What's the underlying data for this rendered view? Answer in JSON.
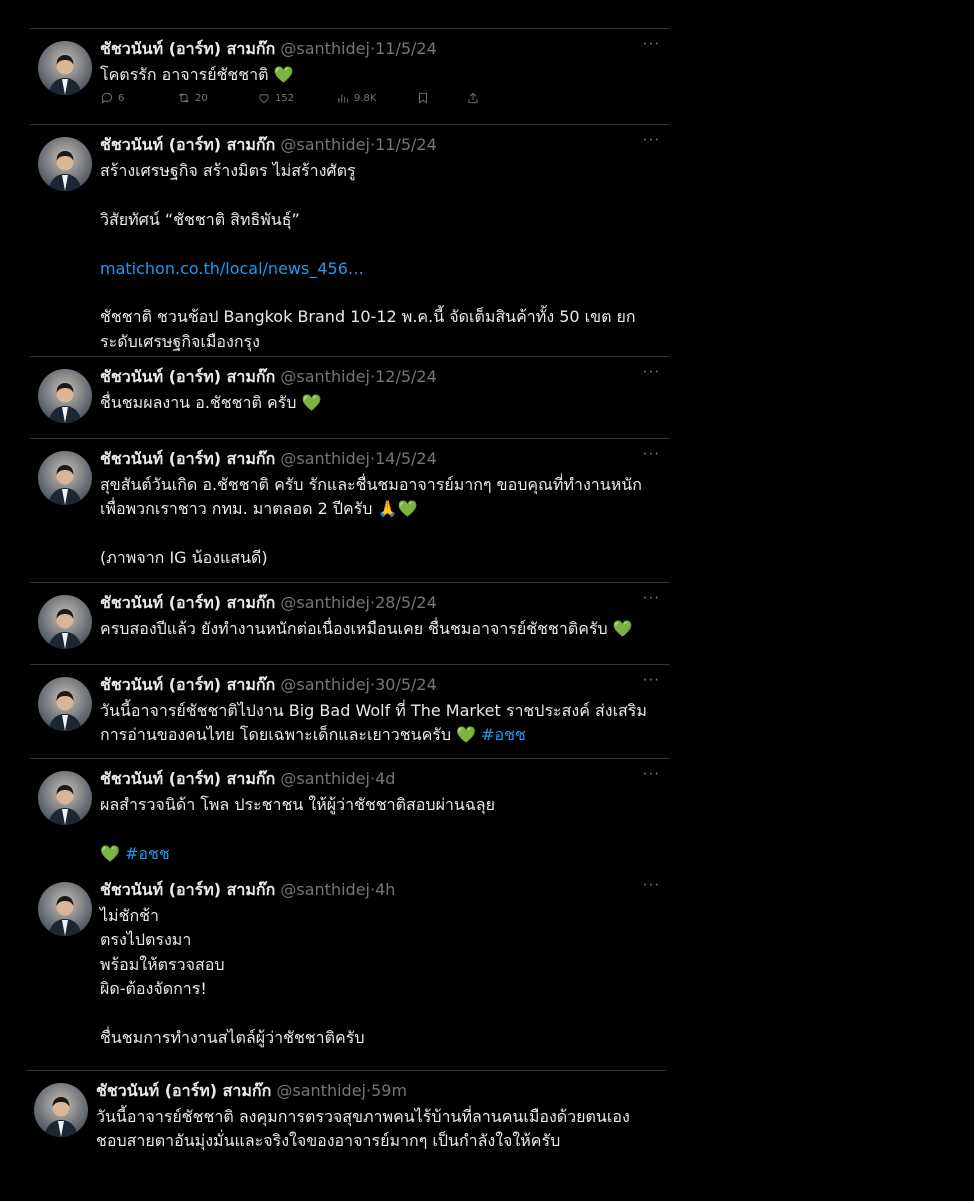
{
  "author": {
    "name": "ชัชวนันท์ (อาร์ท) สามก๊ก",
    "handle": "@santhidej",
    "sep": "·"
  },
  "tweets": [
    {
      "time": "11/5/24",
      "text": "โคตรรัก อาจารย์ชัชชาติ 💚",
      "metrics": {
        "replies": "6",
        "retweets": "20",
        "likes": "152",
        "views": "9.8K"
      }
    },
    {
      "time": "11/5/24",
      "text": "สร้างเศรษฐกิจ สร้างมิตร ไม่สร้างศัตรู\n\nวิสัยทัศน์ “ชัชชาติ สิทธิพันธุ์”\n\n",
      "link": "matichon.co.th/local/news_456…",
      "text_after": "\n\nชัชชาติ ชวนช้อป Bangkok Brand 10-12 พ.ค.นี้ จัดเต็มสินค้าทั้ง 50 เขต ยก\nระดับเศรษฐกิจเมืองกรุง"
    },
    {
      "time": "12/5/24",
      "text": "ชื่นชมผลงาน อ.ชัชชาติ ครับ 💚"
    },
    {
      "time": "14/5/24",
      "text": "สุขสันต์วันเกิด อ.ชัชชาติ ครับ รักและชื่นชมอาจารย์มากๆ ขอบคุณที่ทำงานหนัก\nเพื่อพวกเราชาว กทม. มาตลอด 2 ปีครับ 🙏💚\n\n(ภาพจาก IG น้องแสนดี)"
    },
    {
      "time": "28/5/24",
      "text": "ครบสองปีแล้ว ยังทำงานหนักต่อเนื่องเหมือนเคย ชื่นชมอาจารย์ชัชชาติครับ 💚"
    },
    {
      "time": "30/5/24",
      "text": "วันนี้อาจารย์ชัชชาติไปงาน Big Bad Wolf ที่ The Market ราชประสงค์ ส่งเสริม\nการอ่านของคนไทย โดยเฉพาะเด็กและเยาวชนครับ 💚 ",
      "hashtag": "#อชช"
    },
    {
      "time": "4d",
      "text": "ผลสำรวจนิด้า โพล ประชาชน ให้ผู้ว่าชัชชาติสอบผ่านฉลุย\n\n💚 ",
      "hashtag": "#อชช"
    },
    {
      "time": "4h",
      "text": "ไม่ชักช้า\nตรงไปตรงมา\nพร้อมให้ตรวจสอบ\nผิด-ต้องจัดการ!\n\nชื่นชมการทำงานสไตล์ผู้ว่าชัชชาติครับ"
    },
    {
      "time": "59m",
      "text": "วันนี้อาจารย์ชัชชาติ ลงคุมการตรวจสุขภาพคนไร้บ้านที่ลานคนเมืองด้วยตนเอง\nชอบสายตาอันมุ่งมั่นและจริงใจของอาจารย์มากๆ เป็นกำลังใจให้ครับ"
    }
  ],
  "more_label": "···"
}
